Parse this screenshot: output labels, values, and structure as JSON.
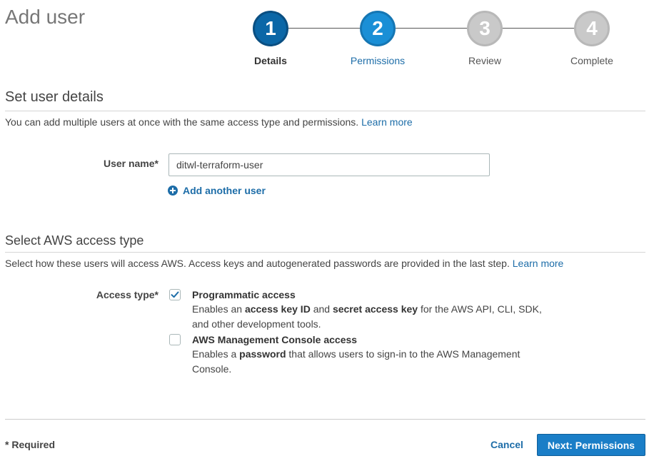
{
  "page": {
    "title": "Add user"
  },
  "wizard": {
    "steps": [
      {
        "number": "1",
        "label": "Details",
        "state": "completed"
      },
      {
        "number": "2",
        "label": "Permissions",
        "state": "active"
      },
      {
        "number": "3",
        "label": "Review",
        "state": "pending"
      },
      {
        "number": "4",
        "label": "Complete",
        "state": "pending"
      }
    ]
  },
  "user_details": {
    "heading": "Set user details",
    "description": "You can add multiple users at once with the same access type and permissions.",
    "learn_more": "Learn more",
    "username_label": "User name*",
    "username_value": "ditwl-terraform-user",
    "add_another_label": "Add another user"
  },
  "access_type": {
    "heading": "Select AWS access type",
    "description": "Select how these users will access AWS. Access keys and autogenerated passwords are provided in the last step.",
    "learn_more": "Learn more",
    "label": "Access type*",
    "options": [
      {
        "title": "Programmatic access",
        "checked": true,
        "desc_parts": [
          "Enables an ",
          "access key ID",
          " and ",
          "secret access key",
          " for the AWS API, CLI, SDK,",
          "and other development tools."
        ]
      },
      {
        "title": "AWS Management Console access",
        "checked": false,
        "desc_parts": [
          "Enables a ",
          "password",
          " that allows users to sign-in to the AWS Management",
          "Console."
        ]
      }
    ]
  },
  "footer": {
    "required_note": "* Required",
    "cancel_label": "Cancel",
    "next_label": "Next: Permissions"
  },
  "colors": {
    "link": "#1d6da8",
    "primary_button": "#1a7ec7",
    "step_completed": "#0b67a7",
    "step_active": "#1a8fd6",
    "step_pending": "#c9c9c9"
  }
}
